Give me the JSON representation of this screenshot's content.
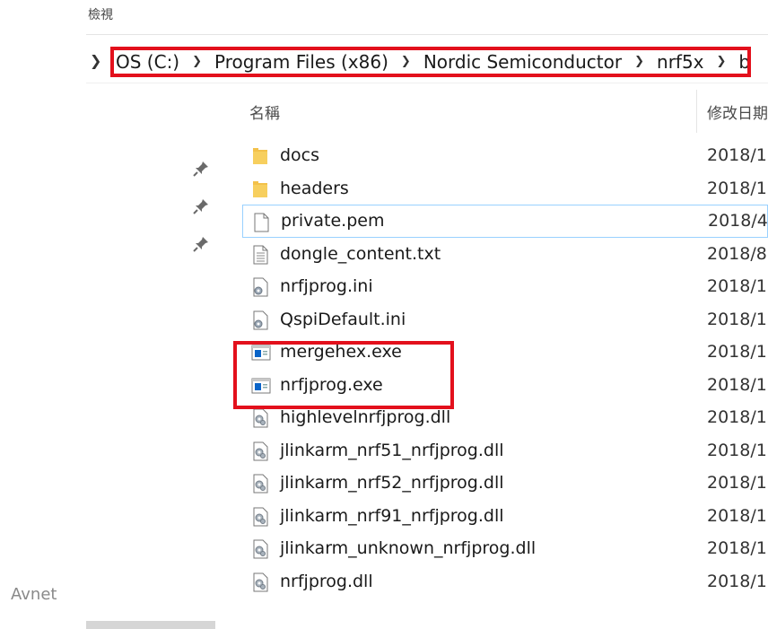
{
  "ribbon": {
    "label": "檢視"
  },
  "address_bar": {
    "crumbs": [
      "OS (C:)",
      "Program Files (x86)",
      "Nordic Semiconductor",
      "nrf5x",
      "bin"
    ]
  },
  "columns": {
    "name": "名稱",
    "date": "修改日期"
  },
  "files": [
    {
      "name": "docs",
      "date": "2018/1",
      "type": "folder"
    },
    {
      "name": "headers",
      "date": "2018/1",
      "type": "folder"
    },
    {
      "name": "private.pem",
      "date": "2018/4",
      "type": "file"
    },
    {
      "name": "dongle_content.txt",
      "date": "2018/8",
      "type": "text"
    },
    {
      "name": "nrfjprog.ini",
      "date": "2018/1",
      "type": "ini"
    },
    {
      "name": "QspiDefault.ini",
      "date": "2018/1",
      "type": "ini"
    },
    {
      "name": "mergehex.exe",
      "date": "2018/1",
      "type": "exe"
    },
    {
      "name": "nrfjprog.exe",
      "date": "2018/1",
      "type": "exe"
    },
    {
      "name": "highlevelnrfjprog.dll",
      "date": "2018/1",
      "type": "dll"
    },
    {
      "name": "jlinkarm_nrf51_nrfjprog.dll",
      "date": "2018/1",
      "type": "dll"
    },
    {
      "name": "jlinkarm_nrf52_nrfjprog.dll",
      "date": "2018/1",
      "type": "dll"
    },
    {
      "name": "jlinkarm_nrf91_nrfjprog.dll",
      "date": "2018/1",
      "type": "dll"
    },
    {
      "name": "jlinkarm_unknown_nrfjprog.dll",
      "date": "2018/1",
      "type": "dll"
    },
    {
      "name": "nrfjprog.dll",
      "date": "2018/1",
      "type": "dll"
    }
  ],
  "watermark": "Avnet",
  "colors": {
    "highlight": "#e3101c",
    "selection": "#99d1ff",
    "folder": "#f7c948",
    "exe": "#0a64c8"
  }
}
